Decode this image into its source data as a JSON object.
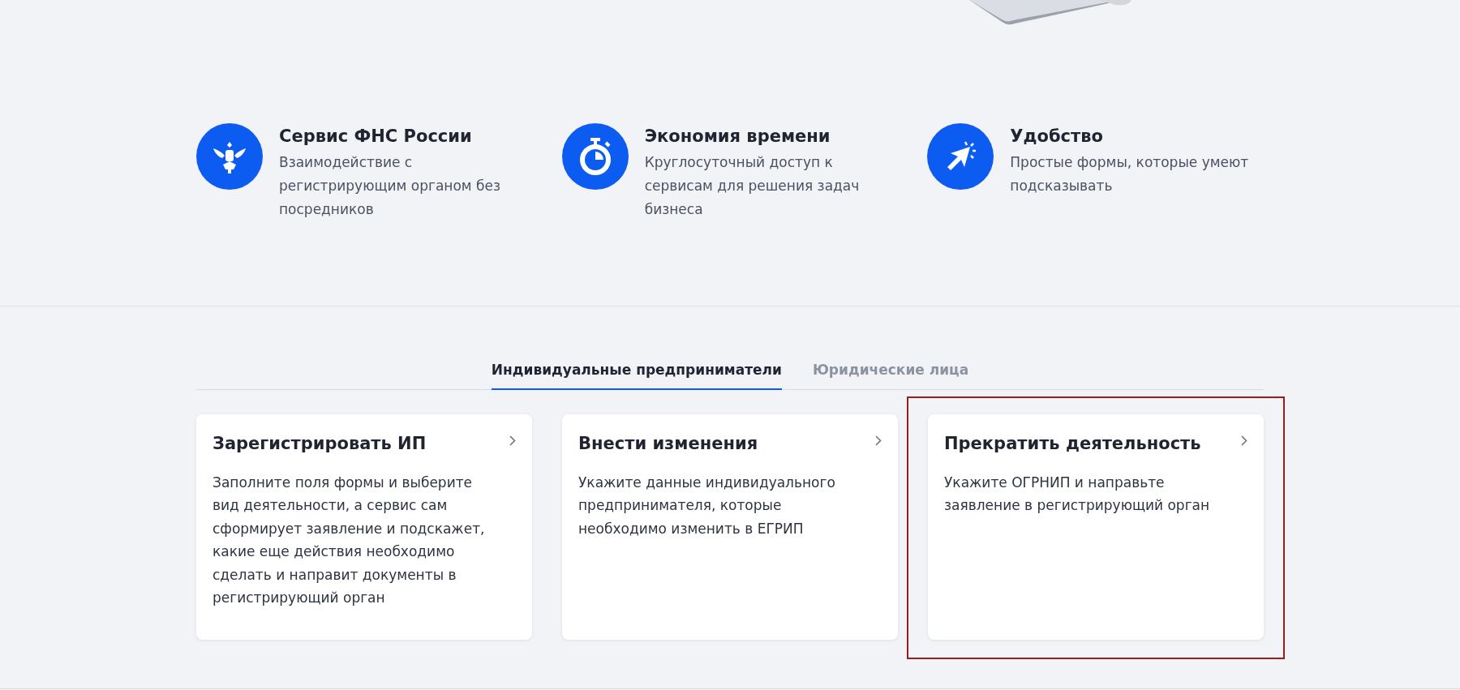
{
  "features": [
    {
      "kind": "emblem",
      "title": "Сервис ФНС России",
      "lines": [
        "Взаимодействие с",
        "регистрирующим органом без",
        "посредников"
      ]
    },
    {
      "kind": "stopwatch",
      "title": "Экономия времени",
      "lines": [
        "Круглосуточный доступ к",
        "сервисам для решения задач",
        "бизнеса"
      ]
    },
    {
      "kind": "cursor",
      "title": "Удобство",
      "lines": [
        "Простые формы, которые умеют",
        "подсказывать"
      ]
    }
  ],
  "tabs": [
    {
      "label": "Индивидуальные предприниматели",
      "selected": true
    },
    {
      "label": "Юридические лица",
      "selected": false
    }
  ],
  "cards": [
    {
      "title": "Зарегистрировать ИП",
      "lines": [
        "Заполните поля формы и выберите",
        "вид деятельности, а сервис сам",
        "сформирует заявление и подскажет,",
        "какие еще действия необходимо",
        "сделать и направит документы в",
        "регистрирующий орган"
      ],
      "highlighted": false
    },
    {
      "title": "Внести изменения",
      "lines": [
        "Укажите данные индивидуального",
        "предпринимателя, которые",
        "необходимо изменить в ЕГРИП"
      ],
      "highlighted": false
    },
    {
      "title": "Прекратить деятельность",
      "lines": [
        "Укажите ОГРНИП и направьте",
        "заявление в регистрирующий орган"
      ],
      "highlighted": true
    }
  ]
}
